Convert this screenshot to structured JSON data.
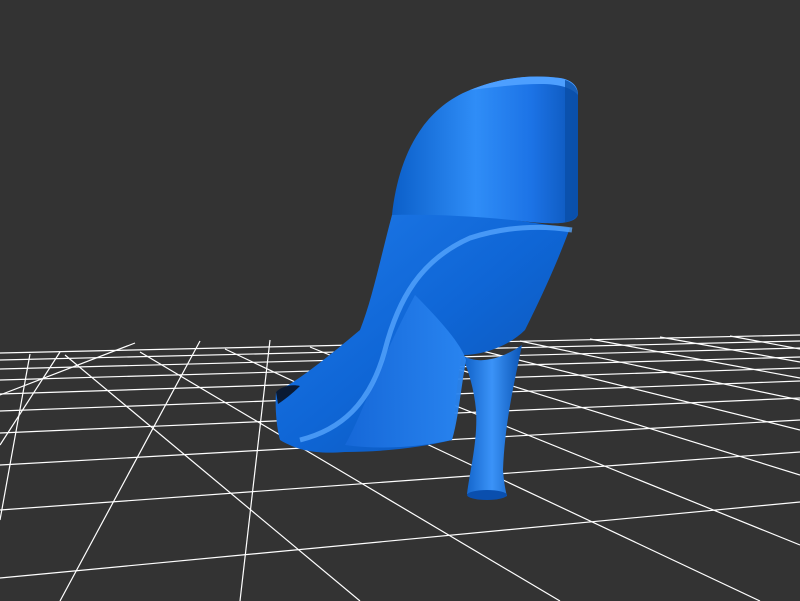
{
  "viewer": {
    "background_color": "#333333",
    "grid_color": "#ffffff",
    "model_color": "#1a73e8",
    "model": "high-heel-shoe"
  }
}
